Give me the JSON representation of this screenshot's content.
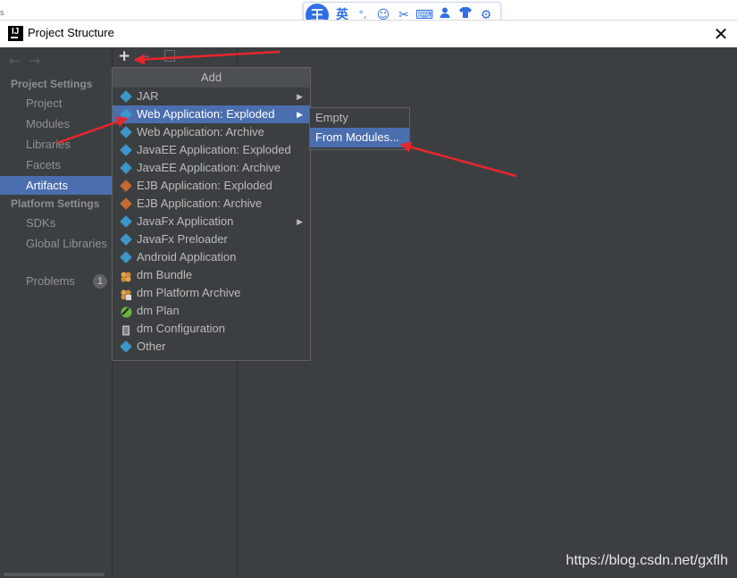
{
  "window": {
    "title": "Project Structure",
    "close_glyph": "✕"
  },
  "top_fragment": "s",
  "ime_toolbar": {
    "logo": "王",
    "buttons": [
      {
        "label": "英",
        "icon": "chinese-english-toggle-icon"
      },
      {
        "label": "°,",
        "icon": "punctuation-icon"
      },
      {
        "label": "☺",
        "icon": "emoji-icon"
      },
      {
        "label": "✂",
        "icon": "scissors-icon"
      },
      {
        "label": "⌨",
        "icon": "keyboard-icon"
      },
      {
        "label": "👤",
        "icon": "user-icon"
      },
      {
        "label": "👕",
        "icon": "skin-icon"
      },
      {
        "label": "⚙",
        "icon": "settings-icon"
      }
    ]
  },
  "nav": {
    "back": "←",
    "forward": "→"
  },
  "sidebar": {
    "sections": [
      {
        "title": "Project Settings"
      },
      {
        "title": "Platform Settings"
      }
    ],
    "items": [
      {
        "label": "Project"
      },
      {
        "label": "Modules"
      },
      {
        "label": "Libraries"
      },
      {
        "label": "Facets"
      },
      {
        "label": "Artifacts",
        "selected": true
      },
      {
        "label": "SDKs"
      },
      {
        "label": "Global Libraries"
      },
      {
        "label": "Problems",
        "badge": "1"
      }
    ]
  },
  "artifacts_toolbar": {
    "add": "+",
    "remove": "−"
  },
  "add_menu": {
    "header": "Add",
    "items": [
      {
        "label": "JAR",
        "icon": "jar-icon",
        "submenu": true
      },
      {
        "label": "Web Application: Exploded",
        "icon": "web-app-icon",
        "submenu": true,
        "active": true
      },
      {
        "label": "Web Application: Archive",
        "icon": "web-app-archive-icon"
      },
      {
        "label": "JavaEE Application: Exploded",
        "icon": "javaee-icon"
      },
      {
        "label": "JavaEE Application: Archive",
        "icon": "javaee-archive-icon"
      },
      {
        "label": "EJB Application: Exploded",
        "icon": "ejb-icon"
      },
      {
        "label": "EJB Application: Archive",
        "icon": "ejb-archive-icon"
      },
      {
        "label": "JavaFx Application",
        "icon": "javafx-icon",
        "submenu": true
      },
      {
        "label": "JavaFx Preloader",
        "icon": "javafx-preloader-icon"
      },
      {
        "label": "Android Application",
        "icon": "android-icon"
      },
      {
        "label": "dm Bundle",
        "icon": "dm-bundle-icon"
      },
      {
        "label": "dm Platform Archive",
        "icon": "dm-platform-icon"
      },
      {
        "label": "dm Plan",
        "icon": "dm-plan-icon"
      },
      {
        "label": "dm Configuration",
        "icon": "dm-configuration-icon"
      },
      {
        "label": "Other",
        "icon": "other-icon"
      }
    ]
  },
  "submenu": {
    "items": [
      {
        "label": "Empty"
      },
      {
        "label": "From Modules...",
        "active": true
      }
    ]
  },
  "watermark": "https://blog.csdn.net/gxflh",
  "colors": {
    "accent": "#4b6eaf",
    "panel": "#3c3f41",
    "annotation_arrow": "#e8262c"
  }
}
